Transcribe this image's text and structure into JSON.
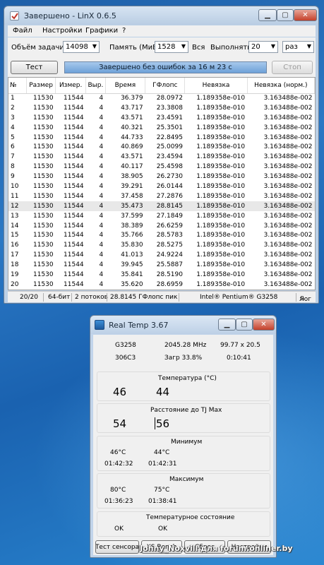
{
  "linx": {
    "title": "Завершено - LinX 0.6.5",
    "menu": [
      "Файл",
      "Настройки",
      "Графики",
      "?"
    ],
    "toolbar": {
      "task_size_label": "Объём задачи:",
      "task_size_value": "14098",
      "memory_label": "Память (МиБ):",
      "memory_value": "1528",
      "all_label": "Вся",
      "run_label": "Выполнять:",
      "run_value": "20",
      "run_unit": "раз",
      "test_button": "Тест",
      "stop_button": "Стоп",
      "progress_text": "Завершено без ошибок за 16 м 23 с"
    },
    "columns": [
      "№",
      "Размер",
      "Измер.",
      "Выр.",
      "Время",
      "ГФлопс",
      "Невязка",
      "Невязка (норм.)"
    ],
    "rows": [
      [
        "1",
        "11530",
        "11544",
        "4",
        "36.379",
        "28.0972",
        "1.189358e-010",
        "3.163488e-002"
      ],
      [
        "2",
        "11530",
        "11544",
        "4",
        "43.717",
        "23.3808",
        "1.189358e-010",
        "3.163488e-002"
      ],
      [
        "3",
        "11530",
        "11544",
        "4",
        "43.571",
        "23.4591",
        "1.189358e-010",
        "3.163488e-002"
      ],
      [
        "4",
        "11530",
        "11544",
        "4",
        "40.321",
        "25.3501",
        "1.189358e-010",
        "3.163488e-002"
      ],
      [
        "5",
        "11530",
        "11544",
        "4",
        "44.733",
        "22.8495",
        "1.189358e-010",
        "3.163488e-002"
      ],
      [
        "6",
        "11530",
        "11544",
        "4",
        "40.869",
        "25.0099",
        "1.189358e-010",
        "3.163488e-002"
      ],
      [
        "7",
        "11530",
        "11544",
        "4",
        "43.571",
        "23.4594",
        "1.189358e-010",
        "3.163488e-002"
      ],
      [
        "8",
        "11530",
        "11544",
        "4",
        "40.117",
        "25.4598",
        "1.189358e-010",
        "3.163488e-002"
      ],
      [
        "9",
        "11530",
        "11544",
        "4",
        "38.905",
        "26.2730",
        "1.189358e-010",
        "3.163488e-002"
      ],
      [
        "10",
        "11530",
        "11544",
        "4",
        "39.291",
        "26.0144",
        "1.189358e-010",
        "3.163488e-002"
      ],
      [
        "11",
        "11530",
        "11544",
        "4",
        "37.458",
        "27.2876",
        "1.189358e-010",
        "3.163488e-002"
      ],
      [
        "12",
        "11530",
        "11544",
        "4",
        "35.473",
        "28.8145",
        "1.189358e-010",
        "3.163488e-002"
      ],
      [
        "13",
        "11530",
        "11544",
        "4",
        "37.599",
        "27.1849",
        "1.189358e-010",
        "3.163488e-002"
      ],
      [
        "14",
        "11530",
        "11544",
        "4",
        "38.389",
        "26.6259",
        "1.189358e-010",
        "3.163488e-002"
      ],
      [
        "15",
        "11530",
        "11544",
        "4",
        "35.766",
        "28.5783",
        "1.189358e-010",
        "3.163488e-002"
      ],
      [
        "16",
        "11530",
        "11544",
        "4",
        "35.830",
        "28.5275",
        "1.189358e-010",
        "3.163488e-002"
      ],
      [
        "17",
        "11530",
        "11544",
        "4",
        "41.013",
        "24.9224",
        "1.189358e-010",
        "3.163488e-002"
      ],
      [
        "18",
        "11530",
        "11544",
        "4",
        "39.945",
        "25.5887",
        "1.189358e-010",
        "3.163488e-002"
      ],
      [
        "19",
        "11530",
        "11544",
        "4",
        "35.841",
        "28.5190",
        "1.189358e-010",
        "3.163488e-002"
      ],
      [
        "20",
        "11530",
        "11544",
        "4",
        "35.620",
        "28.6959",
        "1.189358e-010",
        "3.163488e-002"
      ]
    ],
    "selected_row": 12,
    "status": {
      "count": "20/20",
      "bits": "64-бит",
      "threads": "2 потоков",
      "peak": "28.8145 ГФлопс пик",
      "cpu": "Intel® Pentium® G3258",
      "log": "Лог"
    },
    "log_arrow": ">"
  },
  "realtemp": {
    "title": "Real Temp 3.67",
    "cpu_model": "G3258",
    "frequency": "2045.28 MHz",
    "multiplier": "99.77 x 20.5",
    "stepping": "306C3",
    "load": "Загр  33.8%",
    "uptime": "0:10:41",
    "temp_header": "Температура (°C)",
    "temp_core0": "46",
    "temp_core1": "44",
    "tjmax_header": "Расстояние до TJ Max",
    "tjmax_core0": "54",
    "tjmax_core1": "56",
    "min_header": "Минимум",
    "min_core0": "46°C",
    "min_core1": "44°C",
    "min_time0": "01:42:32",
    "min_time1": "01:42:31",
    "max_header": "Максимум",
    "max_core0": "80°C",
    "max_core1": "75°C",
    "max_time0": "01:36:23",
    "max_time1": "01:38:41",
    "state_header": "Температурное состояние",
    "state_core0": "OK",
    "state_core1": "OK",
    "sensor_test_button": "Тест сенсора",
    "xs_bench_button": "XS Bench",
    "reset_button": "Сброс",
    "settings_button": "Настройки"
  },
  "watermark": "Johny_Noxvill для forum.onliner.by"
}
